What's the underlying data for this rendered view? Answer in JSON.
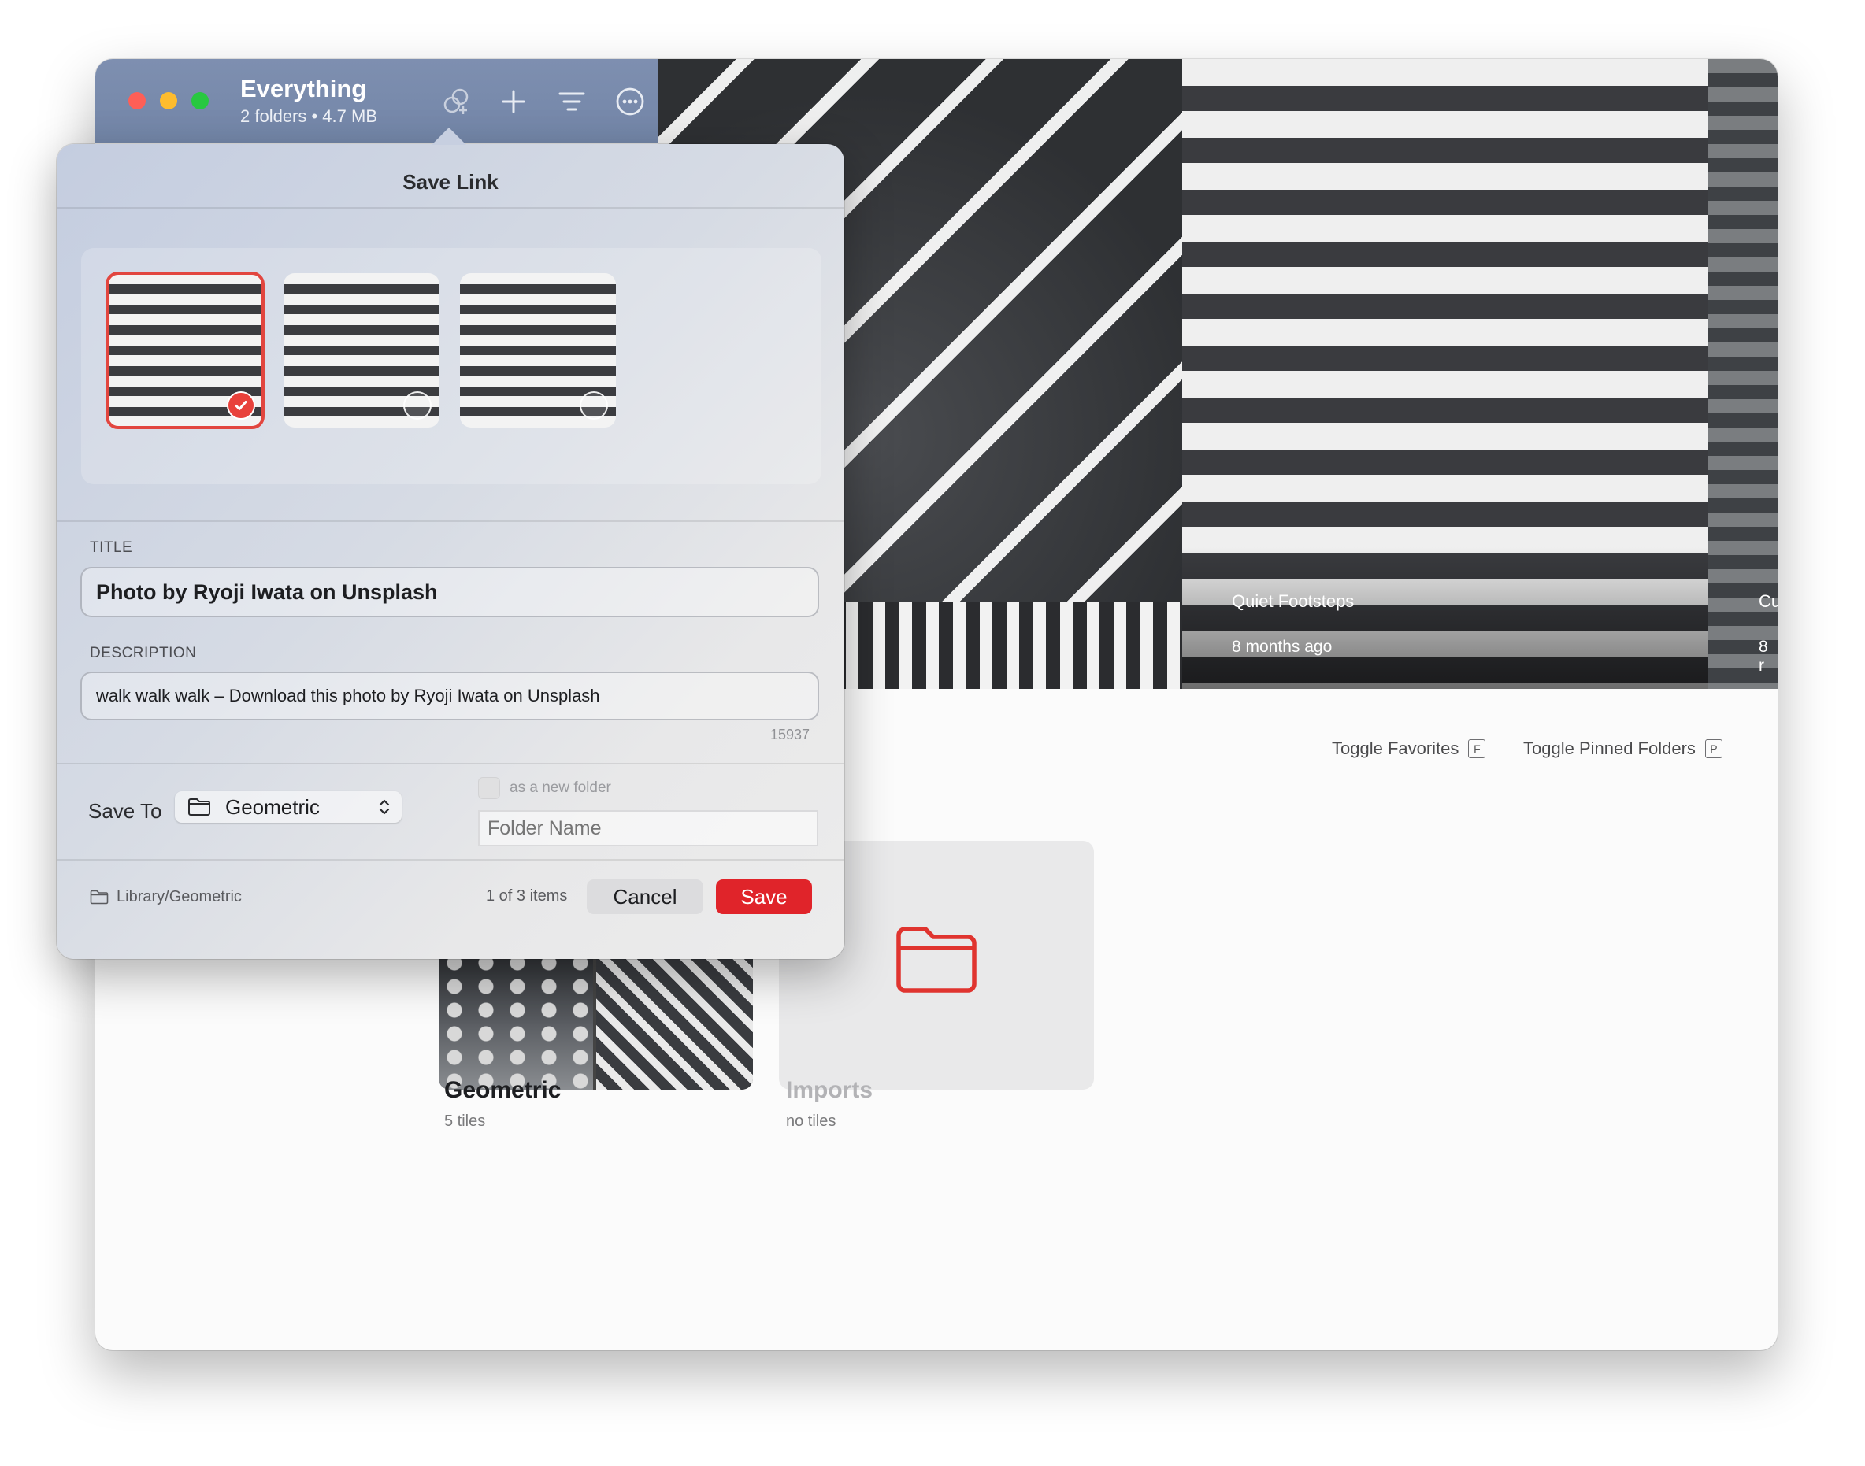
{
  "window": {
    "title": "Everything",
    "subtitle": "2 folders • 4.7 MB"
  },
  "toolbar_icons": [
    "link-icon",
    "plus-icon",
    "filter-icon",
    "more-icon"
  ],
  "photos": [
    {
      "title": "Quiet Footsteps",
      "age": "8 months ago"
    },
    {
      "title": "Cu",
      "age": "8 r"
    }
  ],
  "toggles": {
    "favorites": "Toggle Favorites",
    "favorites_key": "F",
    "pinned": "Toggle Pinned Folders",
    "pinned_key": "P"
  },
  "folders": [
    {
      "name": "Geometric",
      "tiles": "5 tiles"
    },
    {
      "name": "Imports",
      "tiles": "no tiles"
    }
  ],
  "sheet": {
    "title": "Save Link",
    "thumbnails": [
      {
        "selected": true
      },
      {
        "selected": false
      },
      {
        "selected": false
      }
    ],
    "title_label": "TITLE",
    "title_value": "Photo by Ryoji Iwata on Unsplash",
    "description_label": "DESCRIPTION",
    "description_value": "walk walk walk – Download this photo by Ryoji Iwata on Unsplash",
    "char_count": "15937",
    "save_to_label": "Save To",
    "save_to_value": "Geometric",
    "new_folder_label": "as a new folder",
    "folder_name_placeholder": "Folder Name",
    "path": "Library/Geometric",
    "item_count": "1 of 3 items",
    "cancel_label": "Cancel",
    "save_label": "Save"
  },
  "colors": {
    "accent": "#e0242a",
    "titlebar": "#7386a8"
  }
}
